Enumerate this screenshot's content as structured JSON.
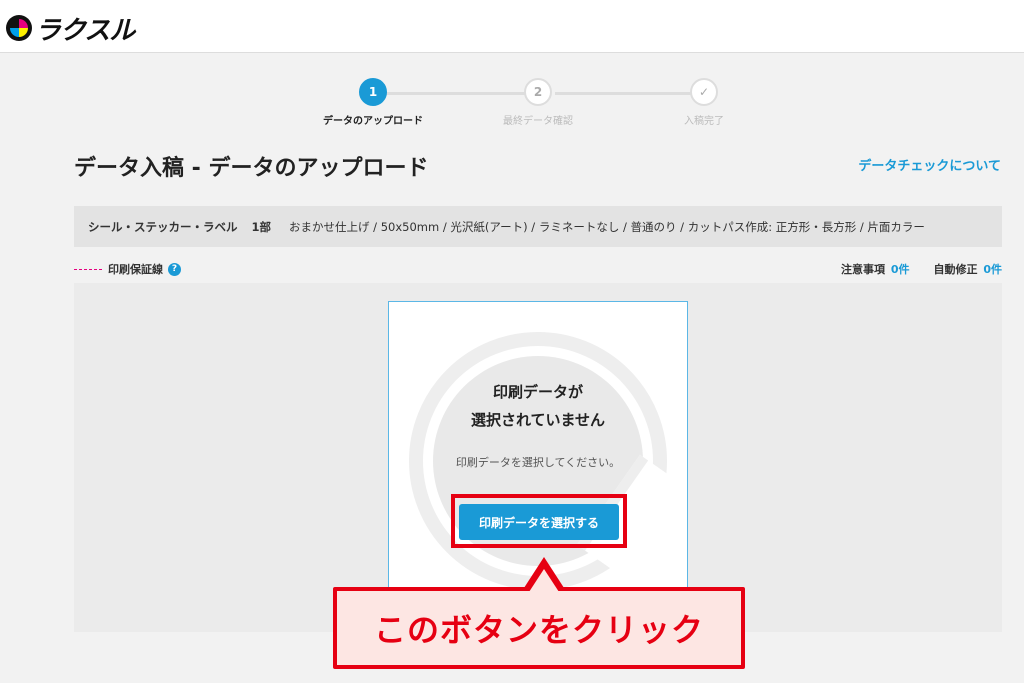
{
  "header": {
    "logo_text": "ラクスル"
  },
  "steps": [
    {
      "number": "1",
      "label": "データのアップロード",
      "active": true
    },
    {
      "number": "2",
      "label": "最終データ確認",
      "active": false
    },
    {
      "number": "✓",
      "label": "入稿完了",
      "active": false
    }
  ],
  "page": {
    "title": "データ入稿 - データのアップロード",
    "help_link": "データチェックについて"
  },
  "spec": {
    "product": "シール・ステッカー・ラベル",
    "quantity": "1部",
    "options": "おまかせ仕上げ / 50x50mm / 光沢紙(アート) / ラミネートなし / 普通のり / カットパス作成: 正方形・長方形 / 片面カラー"
  },
  "legend": {
    "label": "印刷保証線",
    "help_icon": "?"
  },
  "counts": {
    "notice_label": "注意事項",
    "notice_value": "0件",
    "autofix_label": "自動修正",
    "autofix_value": "0件"
  },
  "upload": {
    "title_line1": "印刷データが",
    "title_line2": "選択されていません",
    "subtitle": "印刷データを選択してください。",
    "button_label": "印刷データを選択する"
  },
  "annotation": {
    "callout_text": "このボタンをクリック"
  },
  "colors": {
    "accent": "#1a9ad6",
    "annotation": "#e60012",
    "guide_line": "#e4007f"
  }
}
